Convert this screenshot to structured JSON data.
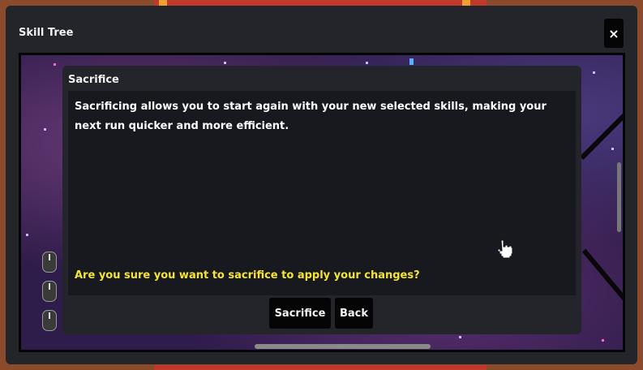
{
  "window": {
    "title": "Skill Tree",
    "close_label": "×"
  },
  "dialog": {
    "title": "Sacrifice",
    "message": "Sacrificing allows you to start again with your new selected skills, making your next run quicker and more efficient.",
    "question": "Are you sure you want to sacrifice to apply your changes?",
    "confirm_label": "Sacrifice",
    "back_label": "Back"
  },
  "colors": {
    "window_bg": "#23252b",
    "dialog_body_bg": "#18191e",
    "question_text": "#f5e430",
    "button_bg": "#050505"
  },
  "icons": [
    "close-icon",
    "mouse-icon",
    "hand-cursor-icon"
  ]
}
